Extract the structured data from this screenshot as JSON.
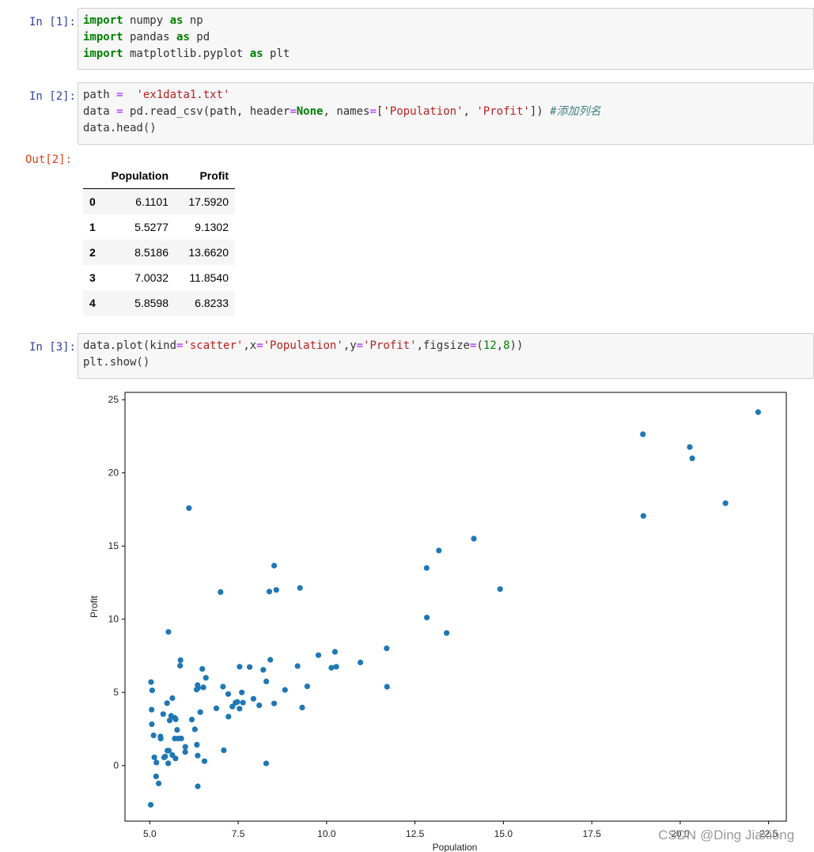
{
  "cells": [
    {
      "prompt": "In  [1]:",
      "code_lines": [
        [
          {
            "t": "import",
            "c": "kw"
          },
          {
            "t": " numpy ",
            "c": ""
          },
          {
            "t": "as",
            "c": "kw"
          },
          {
            "t": " np",
            "c": ""
          }
        ],
        [
          {
            "t": "import",
            "c": "kw"
          },
          {
            "t": " pandas ",
            "c": ""
          },
          {
            "t": "as",
            "c": "kw"
          },
          {
            "t": " pd",
            "c": ""
          }
        ],
        [
          {
            "t": "import",
            "c": "kw"
          },
          {
            "t": " matplotlib.pyplot ",
            "c": ""
          },
          {
            "t": "as",
            "c": "kw"
          },
          {
            "t": " plt",
            "c": ""
          }
        ]
      ]
    },
    {
      "prompt": "In  [2]:",
      "code_lines": [
        [
          {
            "t": "path ",
            "c": ""
          },
          {
            "t": "=",
            "c": "op"
          },
          {
            "t": "  ",
            "c": ""
          },
          {
            "t": "'ex1data1.txt'",
            "c": "str"
          }
        ],
        [
          {
            "t": "data ",
            "c": ""
          },
          {
            "t": "=",
            "c": "op"
          },
          {
            "t": " pd.read_csv(path, header",
            "c": ""
          },
          {
            "t": "=",
            "c": "op"
          },
          {
            "t": "None",
            "c": "kw"
          },
          {
            "t": ", names",
            "c": ""
          },
          {
            "t": "=",
            "c": "op"
          },
          {
            "t": "[",
            "c": ""
          },
          {
            "t": "'Population'",
            "c": "str"
          },
          {
            "t": ", ",
            "c": ""
          },
          {
            "t": "'Profit'",
            "c": "str"
          },
          {
            "t": "]) ",
            "c": ""
          },
          {
            "t": "#添加列名",
            "c": "cmt"
          }
        ],
        [
          {
            "t": "data.head()",
            "c": ""
          }
        ]
      ]
    },
    {
      "prompt": "In  [3]:",
      "code_lines": [
        [
          {
            "t": "data.plot(kind",
            "c": ""
          },
          {
            "t": "=",
            "c": "op"
          },
          {
            "t": "'scatter'",
            "c": "str"
          },
          {
            "t": ",x",
            "c": ""
          },
          {
            "t": "=",
            "c": "op"
          },
          {
            "t": "'Population'",
            "c": "str"
          },
          {
            "t": ",y",
            "c": ""
          },
          {
            "t": "=",
            "c": "op"
          },
          {
            "t": "'Profit'",
            "c": "str"
          },
          {
            "t": ",figsize",
            "c": ""
          },
          {
            "t": "=",
            "c": "op"
          },
          {
            "t": "(",
            "c": ""
          },
          {
            "t": "12",
            "c": "num"
          },
          {
            "t": ",",
            "c": ""
          },
          {
            "t": "8",
            "c": "num"
          },
          {
            "t": "))",
            "c": ""
          }
        ],
        [
          {
            "t": "plt.show()",
            "c": ""
          }
        ]
      ]
    }
  ],
  "output2": {
    "prompt": "Out[2]:",
    "columns": [
      "Population",
      "Profit"
    ],
    "rows": [
      [
        "0",
        "6.1101",
        "17.5920"
      ],
      [
        "1",
        "5.5277",
        "9.1302"
      ],
      [
        "2",
        "8.5186",
        "13.6620"
      ],
      [
        "3",
        "7.0032",
        "11.8540"
      ],
      [
        "4",
        "5.8598",
        "6.8233"
      ]
    ]
  },
  "chart_data": {
    "type": "scatter",
    "xlabel": "Population",
    "ylabel": "Profit",
    "xlim": [
      4.3,
      23.0
    ],
    "ylim": [
      -3.8,
      25.5
    ],
    "xticks": [
      "5.0",
      "7.5",
      "10.0",
      "12.5",
      "15.0",
      "17.5",
      "20.0",
      "22.5"
    ],
    "yticks": [
      "25",
      "20",
      "15",
      "10",
      "5",
      "0"
    ],
    "point_color": "#1f77b4",
    "points": [
      [
        6.1101,
        17.592
      ],
      [
        5.5277,
        9.1302
      ],
      [
        8.5186,
        13.662
      ],
      [
        7.0032,
        11.854
      ],
      [
        5.8598,
        6.8233
      ],
      [
        8.3829,
        11.886
      ],
      [
        7.4764,
        4.3483
      ],
      [
        8.5781,
        12.0
      ],
      [
        6.4862,
        6.5987
      ],
      [
        5.0546,
        3.8166
      ],
      [
        5.7107,
        3.2522
      ],
      [
        14.164,
        15.505
      ],
      [
        5.734,
        3.1551
      ],
      [
        8.4084,
        7.2258
      ],
      [
        5.6407,
        0.71618
      ],
      [
        5.3794,
        3.5129
      ],
      [
        6.3654,
        5.3048
      ],
      [
        5.1301,
        0.56077
      ],
      [
        6.4296,
        3.6518
      ],
      [
        7.0708,
        5.3893
      ],
      [
        6.1891,
        3.1386
      ],
      [
        20.27,
        21.767
      ],
      [
        5.4901,
        4.263
      ],
      [
        6.3261,
        5.1875
      ],
      [
        5.5649,
        3.0825
      ],
      [
        18.945,
        22.638
      ],
      [
        12.828,
        13.501
      ],
      [
        10.957,
        7.0467
      ],
      [
        13.176,
        14.692
      ],
      [
        22.203,
        24.147
      ],
      [
        5.2524,
        -1.22
      ],
      [
        6.5894,
        5.9966
      ],
      [
        9.2482,
        12.134
      ],
      [
        5.8918,
        1.8495
      ],
      [
        8.2111,
        6.5426
      ],
      [
        7.9334,
        4.5623
      ],
      [
        8.0959,
        4.1164
      ],
      [
        5.6063,
        3.3928
      ],
      [
        12.836,
        10.117
      ],
      [
        6.3534,
        5.4974
      ],
      [
        5.4069,
        0.55657
      ],
      [
        6.8825,
        3.9115
      ],
      [
        11.708,
        5.3854
      ],
      [
        5.7737,
        2.4406
      ],
      [
        7.8247,
        6.7318
      ],
      [
        7.0931,
        1.0463
      ],
      [
        5.0702,
        5.1337
      ],
      [
        5.8014,
        1.844
      ],
      [
        11.7,
        8.0043
      ],
      [
        5.5416,
        1.0179
      ],
      [
        7.5402,
        6.7504
      ],
      [
        5.3077,
        1.8396
      ],
      [
        7.4239,
        4.2885
      ],
      [
        7.6031,
        4.9981
      ],
      [
        6.3328,
        1.4233
      ],
      [
        6.3589,
        -1.4211
      ],
      [
        6.2742,
        2.4756
      ],
      [
        5.6397,
        4.6042
      ],
      [
        9.3102,
        3.9624
      ],
      [
        9.4536,
        5.4141
      ],
      [
        8.8254,
        5.1694
      ],
      [
        5.1793,
        -0.74279
      ],
      [
        21.279,
        17.929
      ],
      [
        14.908,
        12.054
      ],
      [
        18.959,
        17.054
      ],
      [
        7.2182,
        4.8852
      ],
      [
        8.2951,
        5.7442
      ],
      [
        10.236,
        7.7754
      ],
      [
        5.4994,
        1.0173
      ],
      [
        20.341,
        20.992
      ],
      [
        10.136,
        6.6799
      ],
      [
        7.3345,
        4.0259
      ],
      [
        6.0062,
        1.2784
      ],
      [
        7.2259,
        3.3411
      ],
      [
        5.0269,
        -2.6807
      ],
      [
        6.5479,
        0.29678
      ],
      [
        7.5386,
        3.8845
      ],
      [
        5.0365,
        5.7014
      ],
      [
        10.274,
        6.7526
      ],
      [
        5.1077,
        2.0576
      ],
      [
        5.7292,
        0.47953
      ],
      [
        5.1884,
        0.20421
      ],
      [
        6.3557,
        0.67861
      ],
      [
        9.7687,
        7.5435
      ],
      [
        6.5159,
        5.3436
      ],
      [
        8.5172,
        4.2415
      ],
      [
        9.1802,
        6.7981
      ],
      [
        6.002,
        0.92695
      ],
      [
        5.5204,
        0.152
      ],
      [
        5.0594,
        2.8214
      ],
      [
        5.7077,
        1.8451
      ],
      [
        7.6366,
        4.2959
      ],
      [
        5.8707,
        7.2029
      ],
      [
        5.3054,
        1.9869
      ],
      [
        8.2934,
        0.14454
      ],
      [
        13.394,
        9.0551
      ],
      [
        5.4369,
        0.61705
      ]
    ]
  },
  "watermark": "CSDN @Ding Jiaxiong"
}
